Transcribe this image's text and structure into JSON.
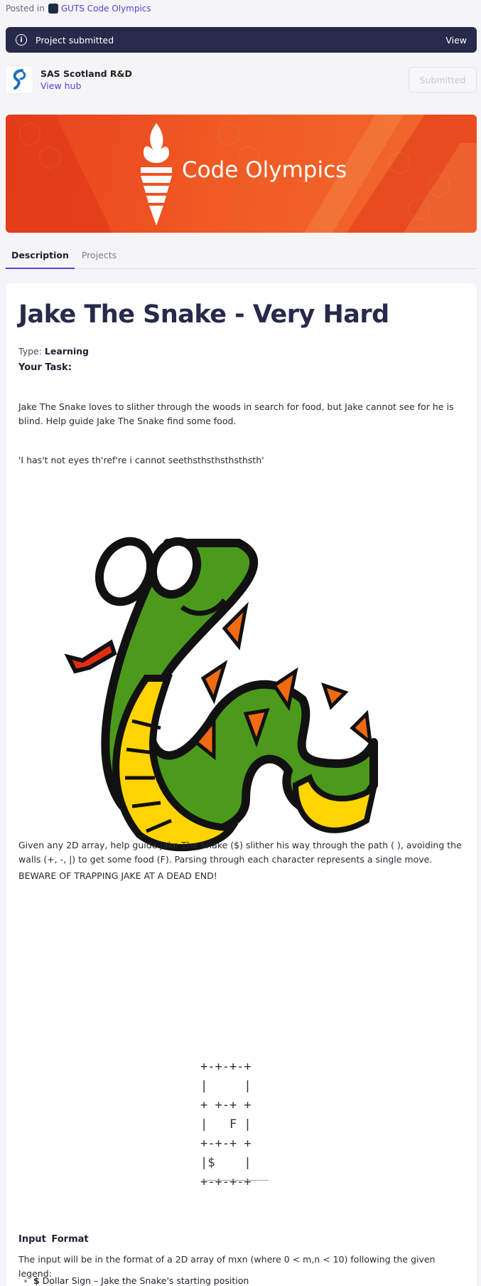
{
  "breadcrumb": {
    "prefix": "Posted in",
    "hub": "GUTS Code Olympics"
  },
  "notice": {
    "text": "Project submitted",
    "action": "View"
  },
  "org": {
    "name": "SAS Scotland R&D",
    "link": "View hub",
    "button": "Submitted"
  },
  "hero": {
    "title": "Code Olympics"
  },
  "tabs": [
    {
      "label": "Description",
      "active": true
    },
    {
      "label": "Projects",
      "active": false
    }
  ],
  "challenge": {
    "title": "Jake The Snake - Very Hard",
    "type_label": "Type:",
    "type_value": "Learning",
    "task_heading": "Your Task:",
    "intro": "Jake The Snake loves to slither through the woods in search for food, but Jake cannot see for he is blind. Help guide Jake The Snake find some food.",
    "quote": "'I has't not eyes th'ref're i cannot seethsthsthsthsthsth'",
    "description": "Given any 2D array, help guide Jake The Snake ($) slither his way through the path ( ), avoiding the walls (+, -, |) to  get some food (F). Parsing through each character represents a single move.",
    "warning": "BEWARE OF TRAPPING JAKE AT A DEAD END!",
    "maze": "+-+-+-+\n|     |\n+ +-+ +\n|   F |\n+-+-+ +\n|$    |\n+-+-+-+",
    "input_heading": "Input  Format",
    "input_desc": "The input will be in the format of a 2D array of mxn (where 0 < m,n < 10) following the given legend:",
    "legend": [
      {
        "symbol": "$",
        "text": "Dollar Sign – Jake the Snake's starting position"
      }
    ]
  },
  "colors": {
    "accent": "#5b3fd6",
    "navy": "#272a4a",
    "hero_orange": "#f05a24"
  }
}
